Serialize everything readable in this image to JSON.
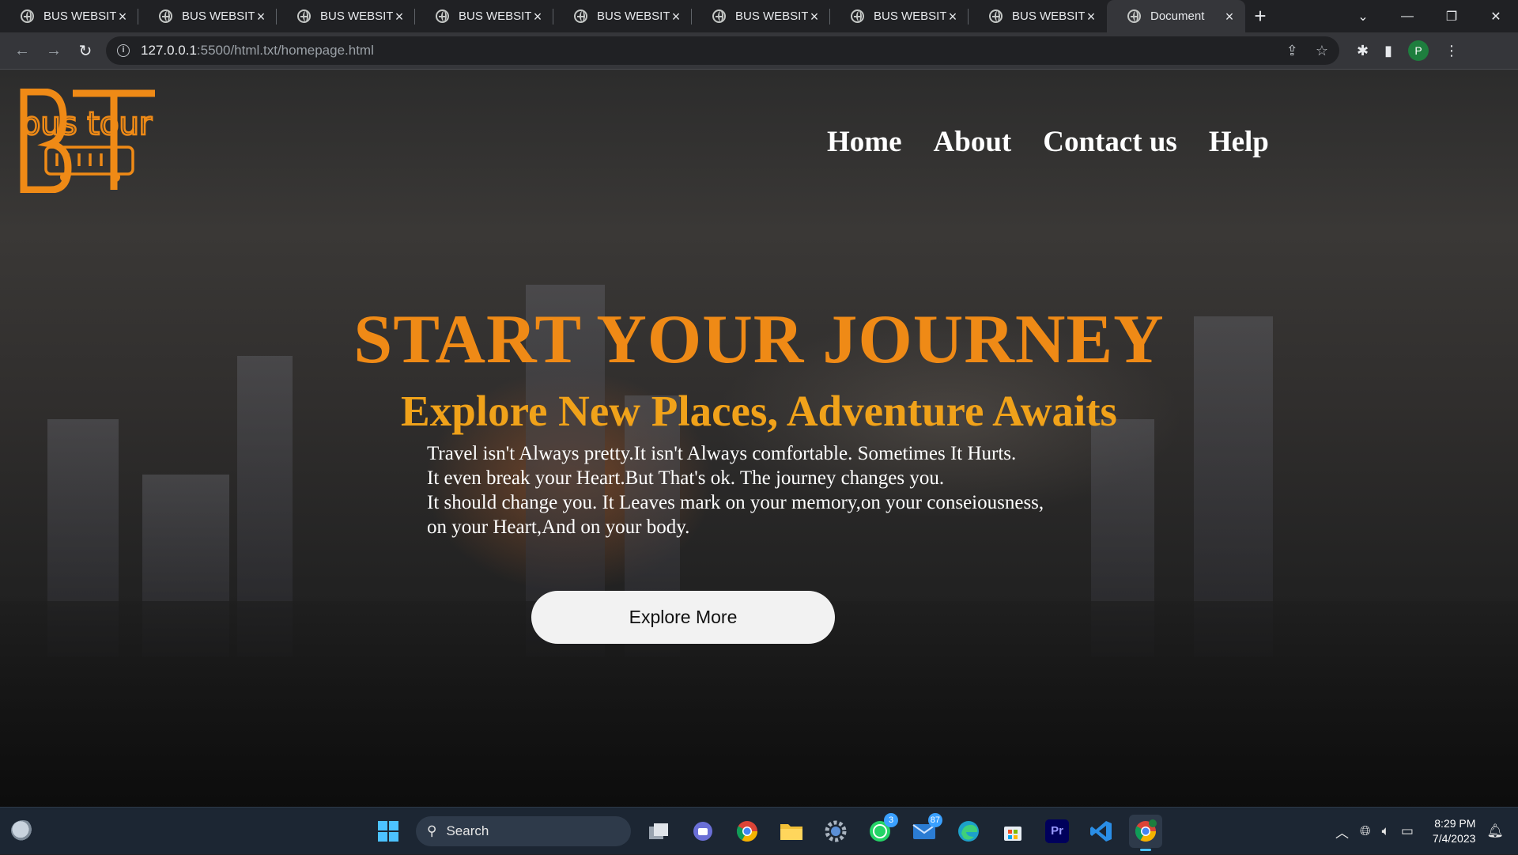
{
  "browser": {
    "tabs": [
      {
        "title": "BUS WEBSITE"
      },
      {
        "title": "BUS WEBSITE"
      },
      {
        "title": "BUS WEBSITE"
      },
      {
        "title": "BUS WEBSITE"
      },
      {
        "title": "BUS WEBSITE"
      },
      {
        "title": "BUS WEBSITE"
      },
      {
        "title": "BUS WEBSITE"
      },
      {
        "title": "BUS WEBSITE"
      },
      {
        "title": "Document"
      }
    ],
    "active_tab_index": 8,
    "url_host": "127.0.0.1",
    "url_path": ":5500/html.txt/homepage.html",
    "profile_initial": "P"
  },
  "page": {
    "logo_text": "bus tour",
    "logo_letters": "BT",
    "nav": [
      "Home",
      "About",
      "Contact us",
      "Help"
    ],
    "hero_title": "START YOUR JOURNEY",
    "hero_subtitle": "Explore New Places, Adventure Awaits",
    "hero_lines": [
      "Travel isn't Always pretty.It isn't Always comfortable. Sometimes It Hurts.",
      "It even break your Heart.But That's ok. The journey changes you.",
      "It should change you. It Leaves mark on your memory,on your conseiousness,",
      "on your Heart,And on your body."
    ],
    "cta_label": "Explore More",
    "colors": {
      "accent": "#ef8a16",
      "subtitle": "#f0a21a",
      "text": "#ffffff"
    }
  },
  "taskbar": {
    "search_label": "Search",
    "icons": [
      {
        "name": "start-icon"
      },
      {
        "name": "task-view-icon"
      },
      {
        "name": "chat-icon"
      },
      {
        "name": "chrome-icon"
      },
      {
        "name": "file-explorer-icon"
      },
      {
        "name": "settings-icon"
      },
      {
        "name": "whatsapp-icon",
        "badge": "3"
      },
      {
        "name": "mail-icon",
        "badge": "87"
      },
      {
        "name": "edge-icon"
      },
      {
        "name": "store-icon"
      },
      {
        "name": "premiere-pro-icon",
        "label": "Pr"
      },
      {
        "name": "vscode-icon"
      },
      {
        "name": "chrome-profile-icon"
      }
    ],
    "time": "8:29 PM",
    "date": "7/4/2023"
  }
}
